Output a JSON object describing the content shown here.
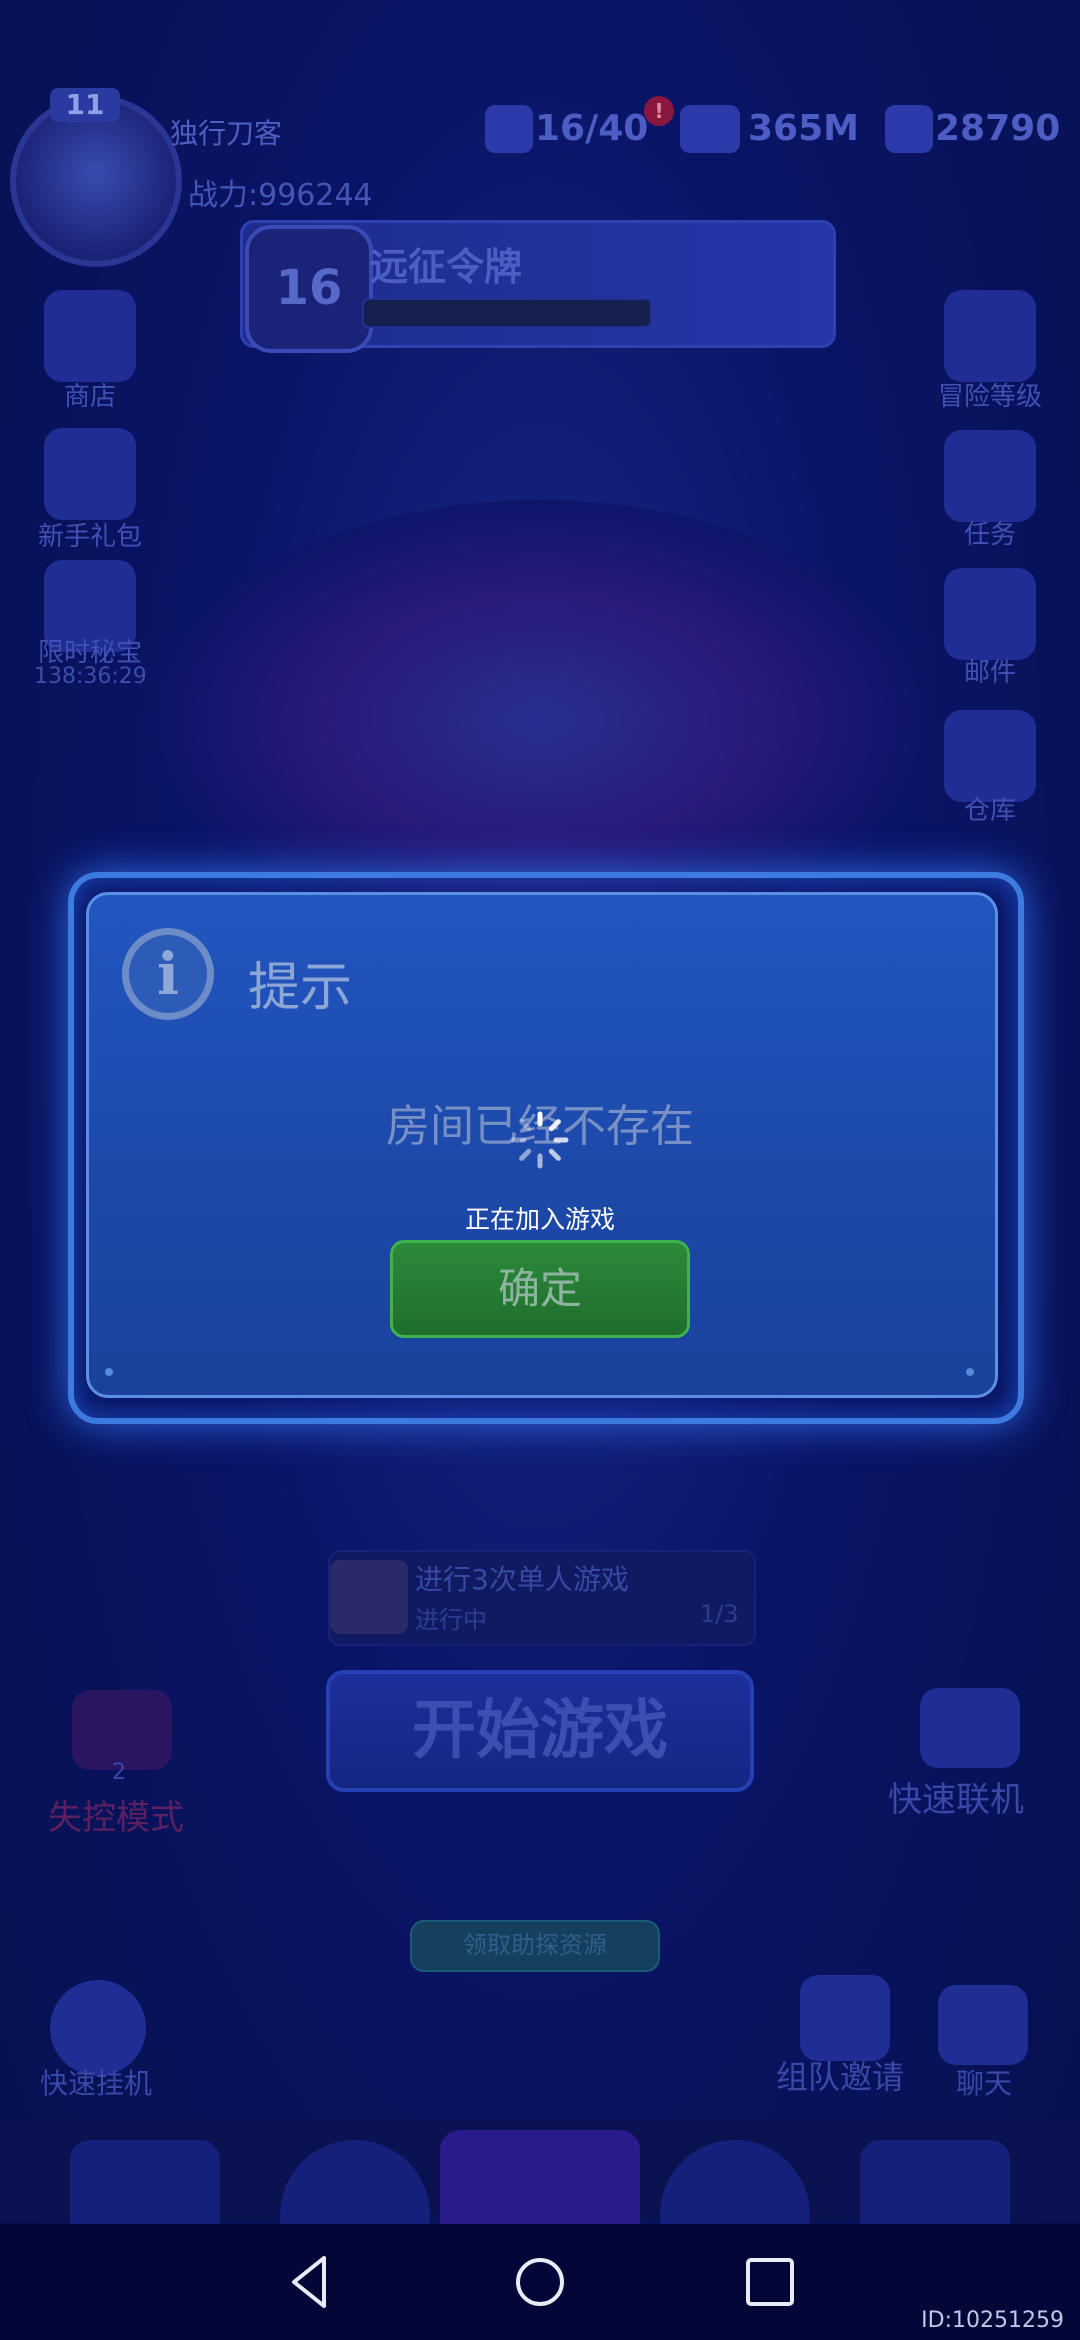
{
  "player": {
    "level": "11",
    "name": "独行刀客",
    "power": "战力:996244"
  },
  "resources": [
    {
      "icon": "energy-icon",
      "value": "16/40"
    },
    {
      "icon": "cash-icon",
      "value": "365M"
    },
    {
      "icon": "gem-icon",
      "value": "28790"
    }
  ],
  "pass": {
    "level": "16",
    "title": "远征令牌"
  },
  "left_menu": [
    {
      "icon": "shop-icon",
      "label": "商店"
    },
    {
      "icon": "gift-icon",
      "label": "新手礼包"
    },
    {
      "icon": "treasure-icon",
      "label": "限时秘宝",
      "timer": "138:36:29"
    }
  ],
  "right_menu": [
    {
      "icon": "adventure-level-icon",
      "label": "冒险等级"
    },
    {
      "icon": "task-icon",
      "label": "任务"
    },
    {
      "icon": "mail-icon",
      "label": "邮件"
    },
    {
      "icon": "warehouse-icon",
      "label": "仓库"
    }
  ],
  "dialog": {
    "title": "提示",
    "message": "房间已经不存在",
    "loading_text": "正在加入游戏",
    "confirm_label": "确定"
  },
  "quest": {
    "title": "进行3次单人游戏",
    "status": "进行中",
    "progress": "1/3"
  },
  "start_button": "开始游戏",
  "modes": {
    "left_label": "失控模式",
    "left_count": "2",
    "right_label": "快速联机"
  },
  "claim_button": "领取助探资源",
  "bottom_actions": {
    "quick_hangup": "快速挂机",
    "team_invite": "组队邀请",
    "chat": "聊天"
  },
  "footer_id": "ID:10251259",
  "colors": {
    "overlay_blue": "#0a1466",
    "dialog_blue": "#1c48a8",
    "confirm_green": "#2c8a3a"
  }
}
